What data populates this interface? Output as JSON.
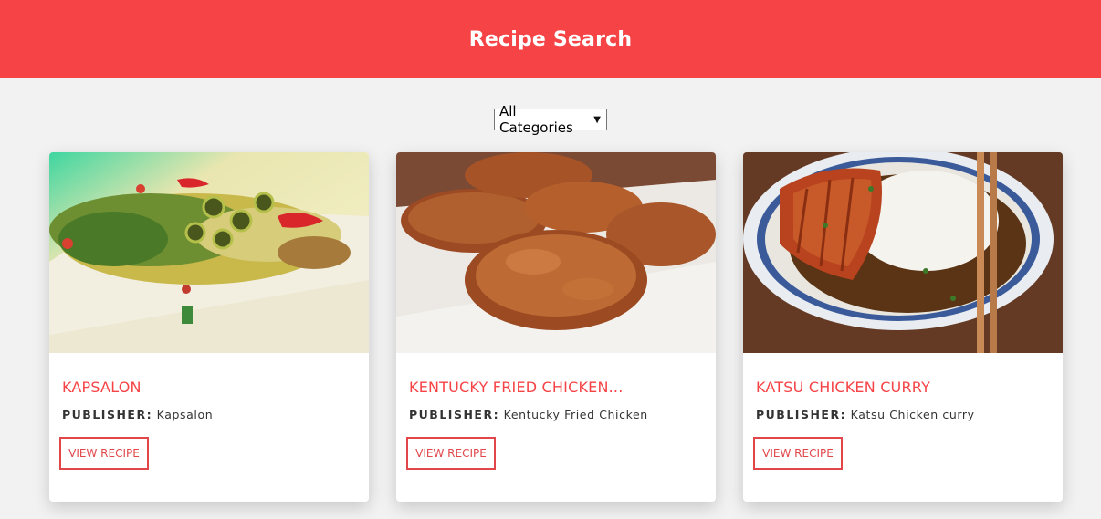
{
  "header": {
    "title": "Recipe Search"
  },
  "filter": {
    "selected": "All Categories"
  },
  "recipes": [
    {
      "title": "Kapsalon",
      "publisher_label": "PUBLISHER:",
      "publisher": "Kapsalon",
      "button": "VIEW RECIPE"
    },
    {
      "title": "Kentucky Fried Chicken...",
      "publisher_label": "PUBLISHER:",
      "publisher": "Kentucky Fried Chicken",
      "button": "VIEW RECIPE"
    },
    {
      "title": "Katsu Chicken Curry",
      "publisher_label": "PUBLISHER:",
      "publisher": "Katsu Chicken curry",
      "button": "VIEW RECIPE"
    }
  ],
  "colors": {
    "accent": "#f64346",
    "background": "#f2f2f2"
  }
}
